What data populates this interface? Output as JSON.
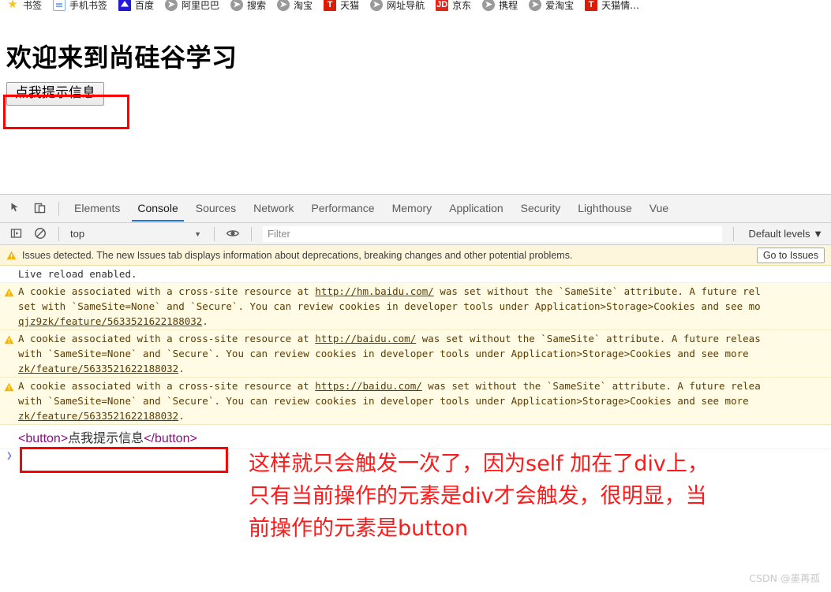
{
  "bookmarks": {
    "items": [
      {
        "label": "书签",
        "icon": "star-icon"
      },
      {
        "label": "手机书签",
        "icon": "phone-bookmarks-icon"
      },
      {
        "label": "百度",
        "icon": "baidu-icon"
      },
      {
        "label": "阿里巴巴",
        "icon": "compass-icon"
      },
      {
        "label": "搜索",
        "icon": "compass-icon"
      },
      {
        "label": "淘宝",
        "icon": "compass-icon"
      },
      {
        "label": "天猫",
        "icon": "tmall-icon"
      },
      {
        "label": "网址导航",
        "icon": "compass-icon"
      },
      {
        "label": "京东",
        "icon": "jd-icon"
      },
      {
        "label": "携程",
        "icon": "compass-icon"
      },
      {
        "label": "爱淘宝",
        "icon": "compass-icon"
      },
      {
        "label": "天猫情…",
        "icon": "tmall-icon"
      }
    ]
  },
  "page": {
    "heading": "欢迎来到尚硅谷学习",
    "button_label": "点我提示信息"
  },
  "devtools": {
    "tabs": [
      {
        "label": "Elements",
        "active": false
      },
      {
        "label": "Console",
        "active": true
      },
      {
        "label": "Sources",
        "active": false
      },
      {
        "label": "Network",
        "active": false
      },
      {
        "label": "Performance",
        "active": false
      },
      {
        "label": "Memory",
        "active": false
      },
      {
        "label": "Application",
        "active": false
      },
      {
        "label": "Security",
        "active": false
      },
      {
        "label": "Lighthouse",
        "active": false
      },
      {
        "label": "Vue",
        "active": false
      }
    ],
    "icons": {
      "inspect": "inspect-element-icon",
      "device": "device-toolbar-icon",
      "sidebar": "console-sidebar-icon",
      "clear": "clear-console-icon",
      "eye": "live-expression-icon"
    },
    "toolbar": {
      "context_value": "top",
      "context_caret": "▼",
      "filter_placeholder": "Filter",
      "levels_label": "Default levels ▼"
    },
    "issues": {
      "text": "Issues detected. The new Issues tab displays information about deprecations, breaking changes and other potential problems.",
      "button_label": "Go to Issues"
    },
    "messages": [
      {
        "level": "info",
        "lines": [
          "Live reload enabled."
        ]
      },
      {
        "level": "warning",
        "lines": [
          "A cookie associated with a cross-site resource at http://hm.baidu.com/ was set without the `SameSite` attribute. A future rel",
          "set with `SameSite=None` and `Secure`. You can review cookies in developer tools under Application>Storage>Cookies and see mo",
          "qjz9zk/feature/5633521622188032."
        ],
        "link": "http://hm.baidu.com/"
      },
      {
        "level": "warning",
        "lines": [
          "A cookie associated with a cross-site resource at http://baidu.com/ was set without the `SameSite` attribute. A future releas",
          "with `SameSite=None` and `Secure`. You can review cookies in developer tools under Application>Storage>Cookies and see more ",
          "zk/feature/5633521622188032."
        ],
        "link": "http://baidu.com/"
      },
      {
        "level": "warning",
        "lines": [
          "A cookie associated with a cross-site resource at https://baidu.com/ was set without the `SameSite` attribute. A future relea",
          "with `SameSite=None` and `Secure`. You can review cookies in developer tools under Application>Storage>Cookies and see more ",
          "zk/feature/5633521622188032."
        ],
        "link": "https://baidu.com/"
      }
    ],
    "output": {
      "open_tag": "<button>",
      "inner_text": "点我提示信息",
      "close_tag": "</button>"
    },
    "prompt_caret": "❯"
  },
  "annotation": {
    "line1": "这样就只会触发一次了，因为self 加在了div上，",
    "line2": "只有当前操作的元素是div才会触发，很明显，当",
    "line3": "前操作的元素是button",
    "color": "#ff1a1a"
  },
  "watermark": "CSDN @墨苒孤"
}
